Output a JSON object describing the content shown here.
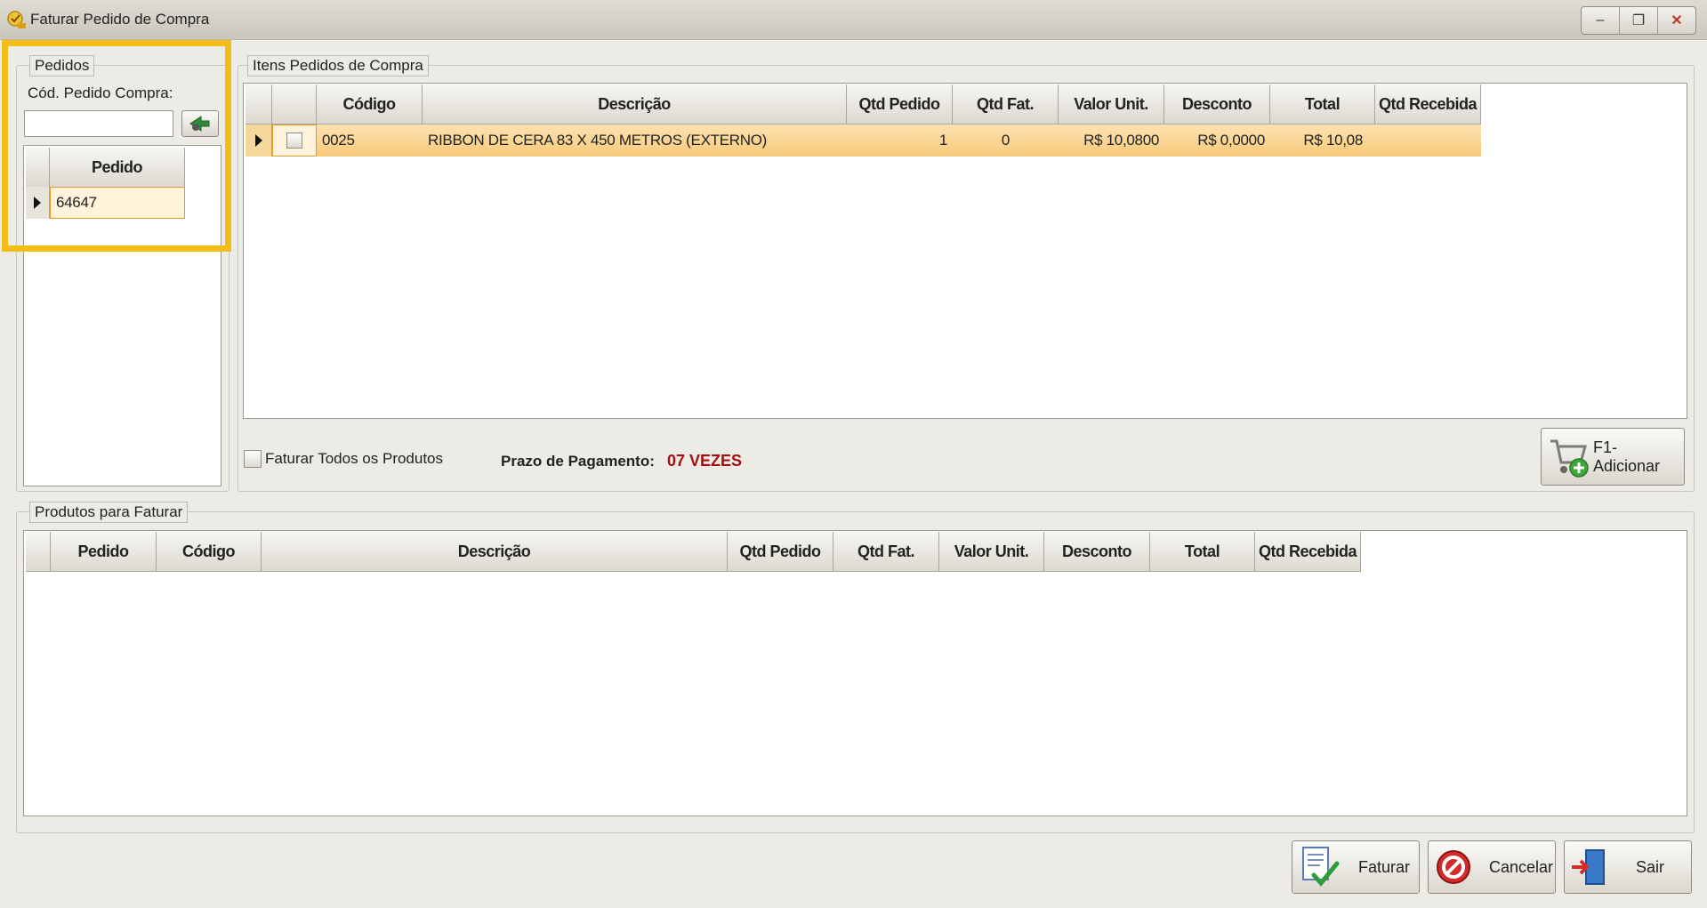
{
  "window": {
    "title": "Faturar Pedido de Compra",
    "minimize": "–",
    "restore": "❐",
    "close": "✕"
  },
  "pedidos": {
    "legend": "Pedidos",
    "cod_label": "Cód. Pedido Compra:",
    "cod_value": "",
    "grid_header": "Pedido",
    "rows": [
      {
        "pedido": "64647"
      }
    ]
  },
  "itens": {
    "legend": "Itens Pedidos de Compra",
    "columns": [
      "Código",
      "Descrição",
      "Qtd Pedido",
      "Qtd Fat.",
      "Valor Unit.",
      "Desconto",
      "Total",
      "Qtd Recebida"
    ],
    "rows": [
      {
        "codigo": "0025",
        "descricao": "RIBBON DE CERA 83 X 450 METROS (EXTERNO)",
        "qtd_pedido": "1",
        "qtd_fat": "0",
        "valor_unit": "R$ 10,0800",
        "desconto": "R$ 0,0000",
        "total": "R$ 10,08",
        "qtd_recebida": ""
      }
    ],
    "faturar_todos_label": "Faturar Todos os Produtos",
    "prazo_label": "Prazo de Pagamento:",
    "prazo_value": "07 VEZES",
    "adicionar_label": "F1-Adicionar"
  },
  "produtos": {
    "legend": "Produtos para Faturar",
    "columns": [
      "Pedido",
      "Código",
      "Descrição",
      "Qtd Pedido",
      "Qtd Fat.",
      "Valor Unit.",
      "Desconto",
      "Total",
      "Qtd Recebida"
    ]
  },
  "actions": {
    "faturar": "Faturar",
    "cancelar": "Cancelar",
    "sair": "Sair"
  },
  "colors": {
    "highlight": "#f2bd14",
    "selected_row": "#f7c97a",
    "prazo": "#a01010"
  }
}
